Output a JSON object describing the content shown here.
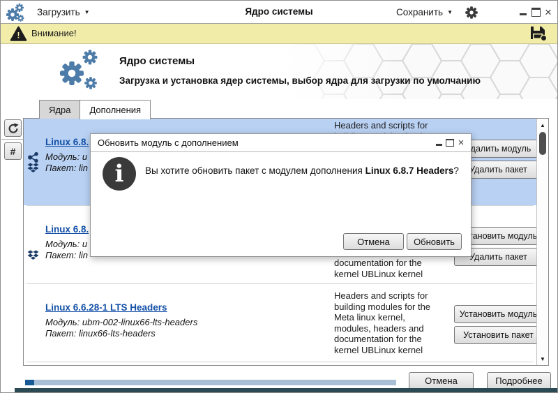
{
  "window": {
    "load_label": "Загрузить",
    "title": "Ядро системы",
    "save_label": "Сохранить",
    "close_glyph": "×"
  },
  "warning": {
    "label": "Внимание!"
  },
  "header": {
    "title": "Ядро системы",
    "subtitle": "Загрузка и установка ядер системы, выбор ядра для загрузки по умолчанию"
  },
  "tabs": {
    "kernels": "Ядра",
    "addons": "Дополнения"
  },
  "sidebar": {
    "hash_label": "#"
  },
  "list": {
    "items": [
      {
        "title": "Linux 6.8.",
        "module_label": "Модуль:",
        "module": "u",
        "package_label": "Пакет:",
        "package": "lin",
        "description": "Headers and scripts for building modules for the Meta linux kernel, modules, headers and documentation for the kernel UBLinux kernel",
        "button1": "Удалить модуль",
        "button2": "Удалить пакет",
        "selected": true
      },
      {
        "title": "Linux 6.8.",
        "module_label": "Модуль:",
        "module": "u",
        "package_label": "Пакет:",
        "package": "lin",
        "description": "Headers and scripts for building modules for the Meta linux kernel, modules, headers and documentation for the kernel UBLinux kernel",
        "button1": "Установить модуль",
        "button2": "Удалить пакет",
        "selected": false
      },
      {
        "title": "Linux 6.6.28-1 LTS Headers",
        "module_label": "Модуль:",
        "module": "ubm-002-linux66-lts-headers",
        "package_label": "Пакет:",
        "package": "linux66-lts-headers",
        "description": "Headers and scripts for building modules for the Meta linux kernel, modules, headers and documentation for the kernel UBLinux kernel",
        "button1": "Установить модуль",
        "button2": "Установить пакет",
        "selected": false
      }
    ]
  },
  "dialog": {
    "title": "Обновить модуль с дополнением",
    "message_prefix": "Вы хотите обновить пакет с модулем дополнения ",
    "message_bold": "Linux 6.8.7 Headers",
    "message_suffix": "?",
    "cancel_label": "Отмена",
    "ok_label": "Обновить",
    "close_glyph": "×"
  },
  "footer": {
    "cancel_label": "Отмена",
    "details_label": "Подробнее",
    "progress_percent": 2,
    "progress_style": "width:13px"
  },
  "glyphs": {
    "dropdown": "▼",
    "scroll_up": "▲",
    "scroll_down": "▼"
  },
  "colors": {
    "accent_blue": "#4d7ca9",
    "selection_blue": "#b9d1f3",
    "link_blue": "#1551a8",
    "warning_bg": "#f1eda9",
    "progress_track": "#a9bfd6",
    "progress_fill": "#175a96",
    "bottom_strip": "#2c4a54"
  }
}
